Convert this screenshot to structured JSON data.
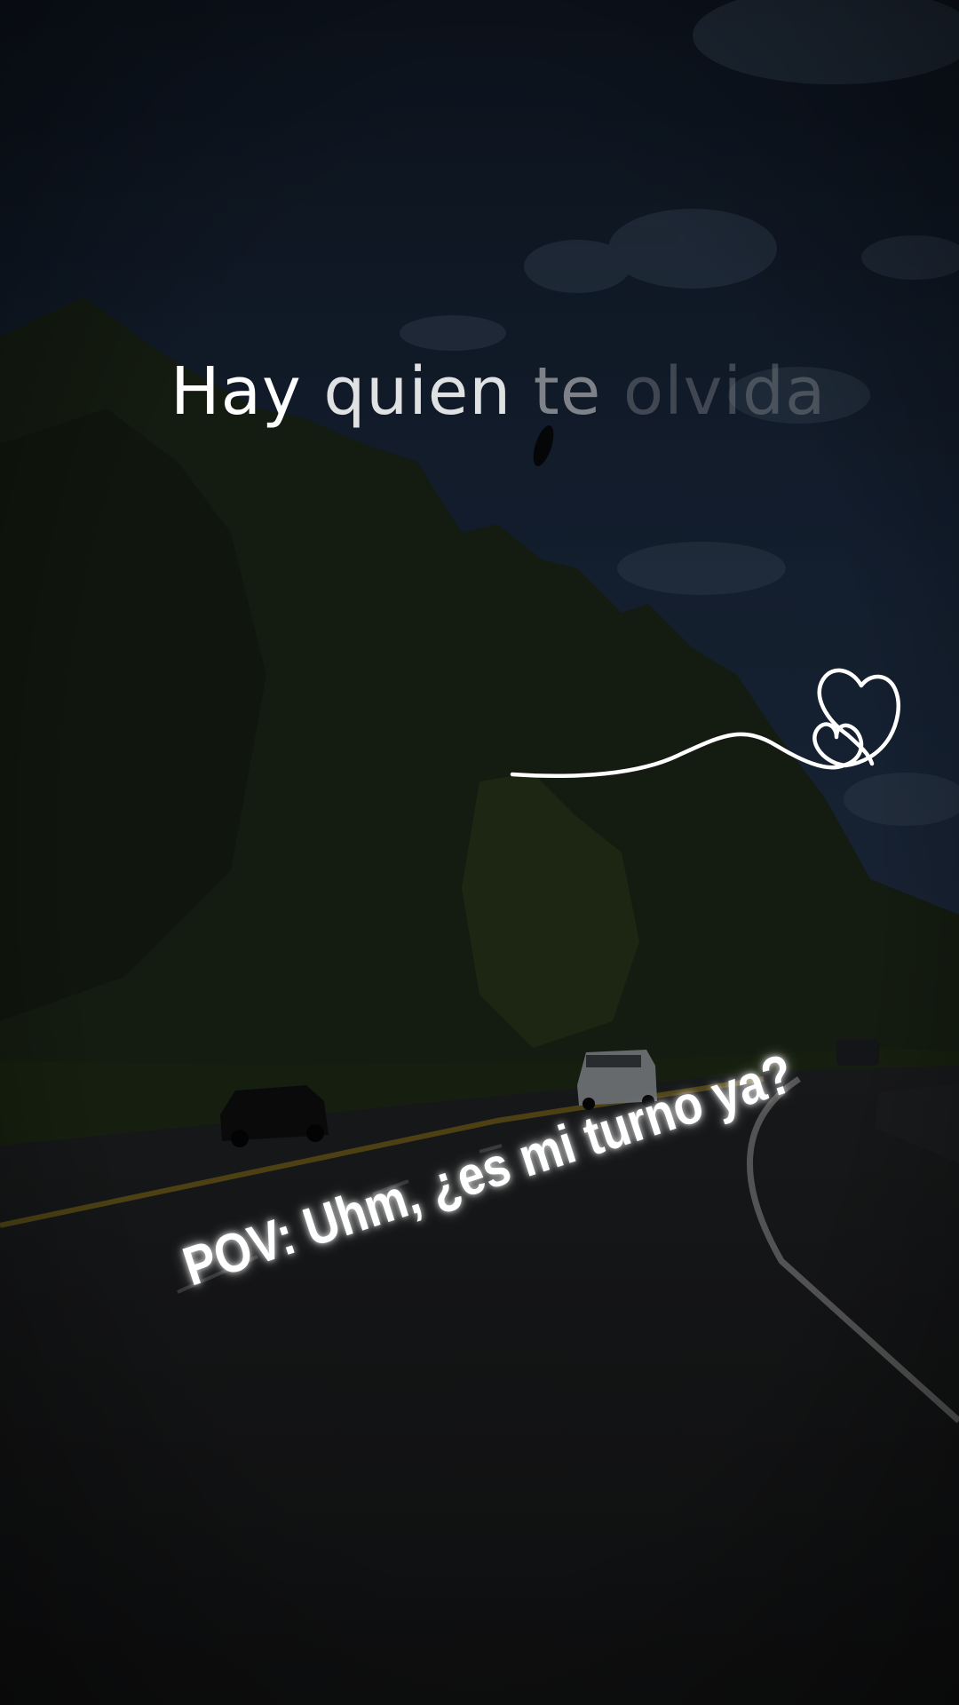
{
  "overlay": {
    "lyric_words": [
      "Hay",
      "quien",
      "te",
      "olvida"
    ],
    "caption": "POV: Uhm, ¿es mi turno ya?"
  },
  "icons": {
    "decoration": "scribble-hearts-icon"
  },
  "colors": {
    "sky": "#1b2a40",
    "foliage": "#1f2a18",
    "road": "#1c1d1f",
    "text": "#ffffff"
  }
}
